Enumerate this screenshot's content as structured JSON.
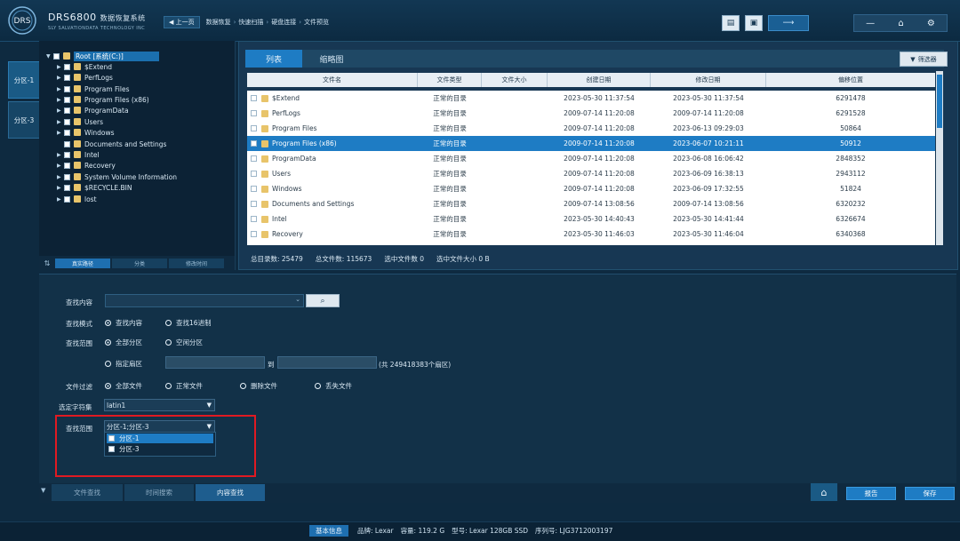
{
  "header": {
    "logo_text": "DRS",
    "title": "DRS6800",
    "title_cn": "数据恢复系统",
    "subtitle": "SLY SALVATIONDATA TECHNOLOGY INC",
    "back_label": "◀ 上一页",
    "breadcrumb": [
      "数据恢复",
      "快速扫描",
      "硬盘连接",
      "文件预览"
    ],
    "tool_icons": [
      "report-icon",
      "briefcase-icon",
      "arrow-icon"
    ],
    "window_icons": [
      "minimize-icon",
      "home-icon",
      "gear-icon"
    ]
  },
  "left_tabs": [
    "分区-1",
    "分区-3"
  ],
  "tree": {
    "root": "Root [系统(C:)]",
    "items": [
      "$Extend",
      "PerfLogs",
      "Program Files",
      "Program Files (x86)",
      "ProgramData",
      "Users",
      "Windows",
      "Documents and Settings",
      "Intel",
      "Recovery",
      "System Volume Information",
      "$RECYCLE.BIN",
      "lost"
    ],
    "footer_buttons": [
      "真实路径",
      "分类",
      "修改时间"
    ]
  },
  "view_tabs": {
    "list": "列表",
    "thumb": "缩略图",
    "filter": "筛选器"
  },
  "grid": {
    "columns": [
      "文件名",
      "文件类型",
      "文件大小",
      "创建日期",
      "修改日期",
      "偏移位置"
    ],
    "rows": [
      {
        "name": "$Extend",
        "type": "正常的目录",
        "size": "",
        "created": "2023-05-30 11:37:54",
        "modified": "2023-05-30 11:37:54",
        "offset": "6291478"
      },
      {
        "name": "PerfLogs",
        "type": "正常的目录",
        "size": "",
        "created": "2009-07-14 11:20:08",
        "modified": "2009-07-14 11:20:08",
        "offset": "6291528"
      },
      {
        "name": "Program Files",
        "type": "正常的目录",
        "size": "",
        "created": "2009-07-14 11:20:08",
        "modified": "2023-06-13 09:29:03",
        "offset": "50864"
      },
      {
        "name": "Program Files (x86)",
        "type": "正常的目录",
        "size": "",
        "created": "2009-07-14 11:20:08",
        "modified": "2023-06-07 10:21:11",
        "offset": "50912"
      },
      {
        "name": "ProgramData",
        "type": "正常的目录",
        "size": "",
        "created": "2009-07-14 11:20:08",
        "modified": "2023-06-08 16:06:42",
        "offset": "2848352"
      },
      {
        "name": "Users",
        "type": "正常的目录",
        "size": "",
        "created": "2009-07-14 11:20:08",
        "modified": "2023-06-09 16:38:13",
        "offset": "2943112"
      },
      {
        "name": "Windows",
        "type": "正常的目录",
        "size": "",
        "created": "2009-07-14 11:20:08",
        "modified": "2023-06-09 17:32:55",
        "offset": "51824"
      },
      {
        "name": "Documents and Settings",
        "type": "正常的目录",
        "size": "",
        "created": "2009-07-14 13:08:56",
        "modified": "2009-07-14 13:08:56",
        "offset": "6320232"
      },
      {
        "name": "Intel",
        "type": "正常的目录",
        "size": "",
        "created": "2023-05-30 14:40:43",
        "modified": "2023-05-30 14:41:44",
        "offset": "6326674"
      },
      {
        "name": "Recovery",
        "type": "正常的目录",
        "size": "",
        "created": "2023-05-30 11:46:03",
        "modified": "2023-05-30 11:46:04",
        "offset": "6340368"
      }
    ]
  },
  "status": [
    "总目录数: 25479",
    "总文件数: 115673",
    "选中文件数 0",
    "选中文件大小 0 B"
  ],
  "search": {
    "content_label": "查找内容",
    "mode_label": "查找模式",
    "mode_options": [
      "查找内容",
      "查找16进制"
    ],
    "range_label": "查找范围",
    "range_options": [
      "全部分区",
      "空闲分区"
    ],
    "sector_option": "指定扇区",
    "to_label": "到",
    "total_sectors": "(共 249418383个扇区)",
    "filter_label": "文件过滤",
    "filter_options": [
      "全部文件",
      "正常文件",
      "删除文件",
      "丢失文件"
    ],
    "charset_label": "选定字符集",
    "charset_value": "latin1",
    "scope_label": "查找范围",
    "scope_value": "分区-1;分区-3",
    "scope_items": [
      "分区-1",
      "分区-3"
    ]
  },
  "bottom_tabs": [
    "文件查找",
    "时间搜索",
    "内容查找"
  ],
  "actions": {
    "report": "报告",
    "save": "保存"
  },
  "footer": {
    "basic_info": "基本信息",
    "brand": "品牌:  Lexar",
    "capacity": "容量:  119.2 G",
    "model": "型号:  Lexar 128GB SSD",
    "serial": "序列号:  LJG3712003197"
  }
}
